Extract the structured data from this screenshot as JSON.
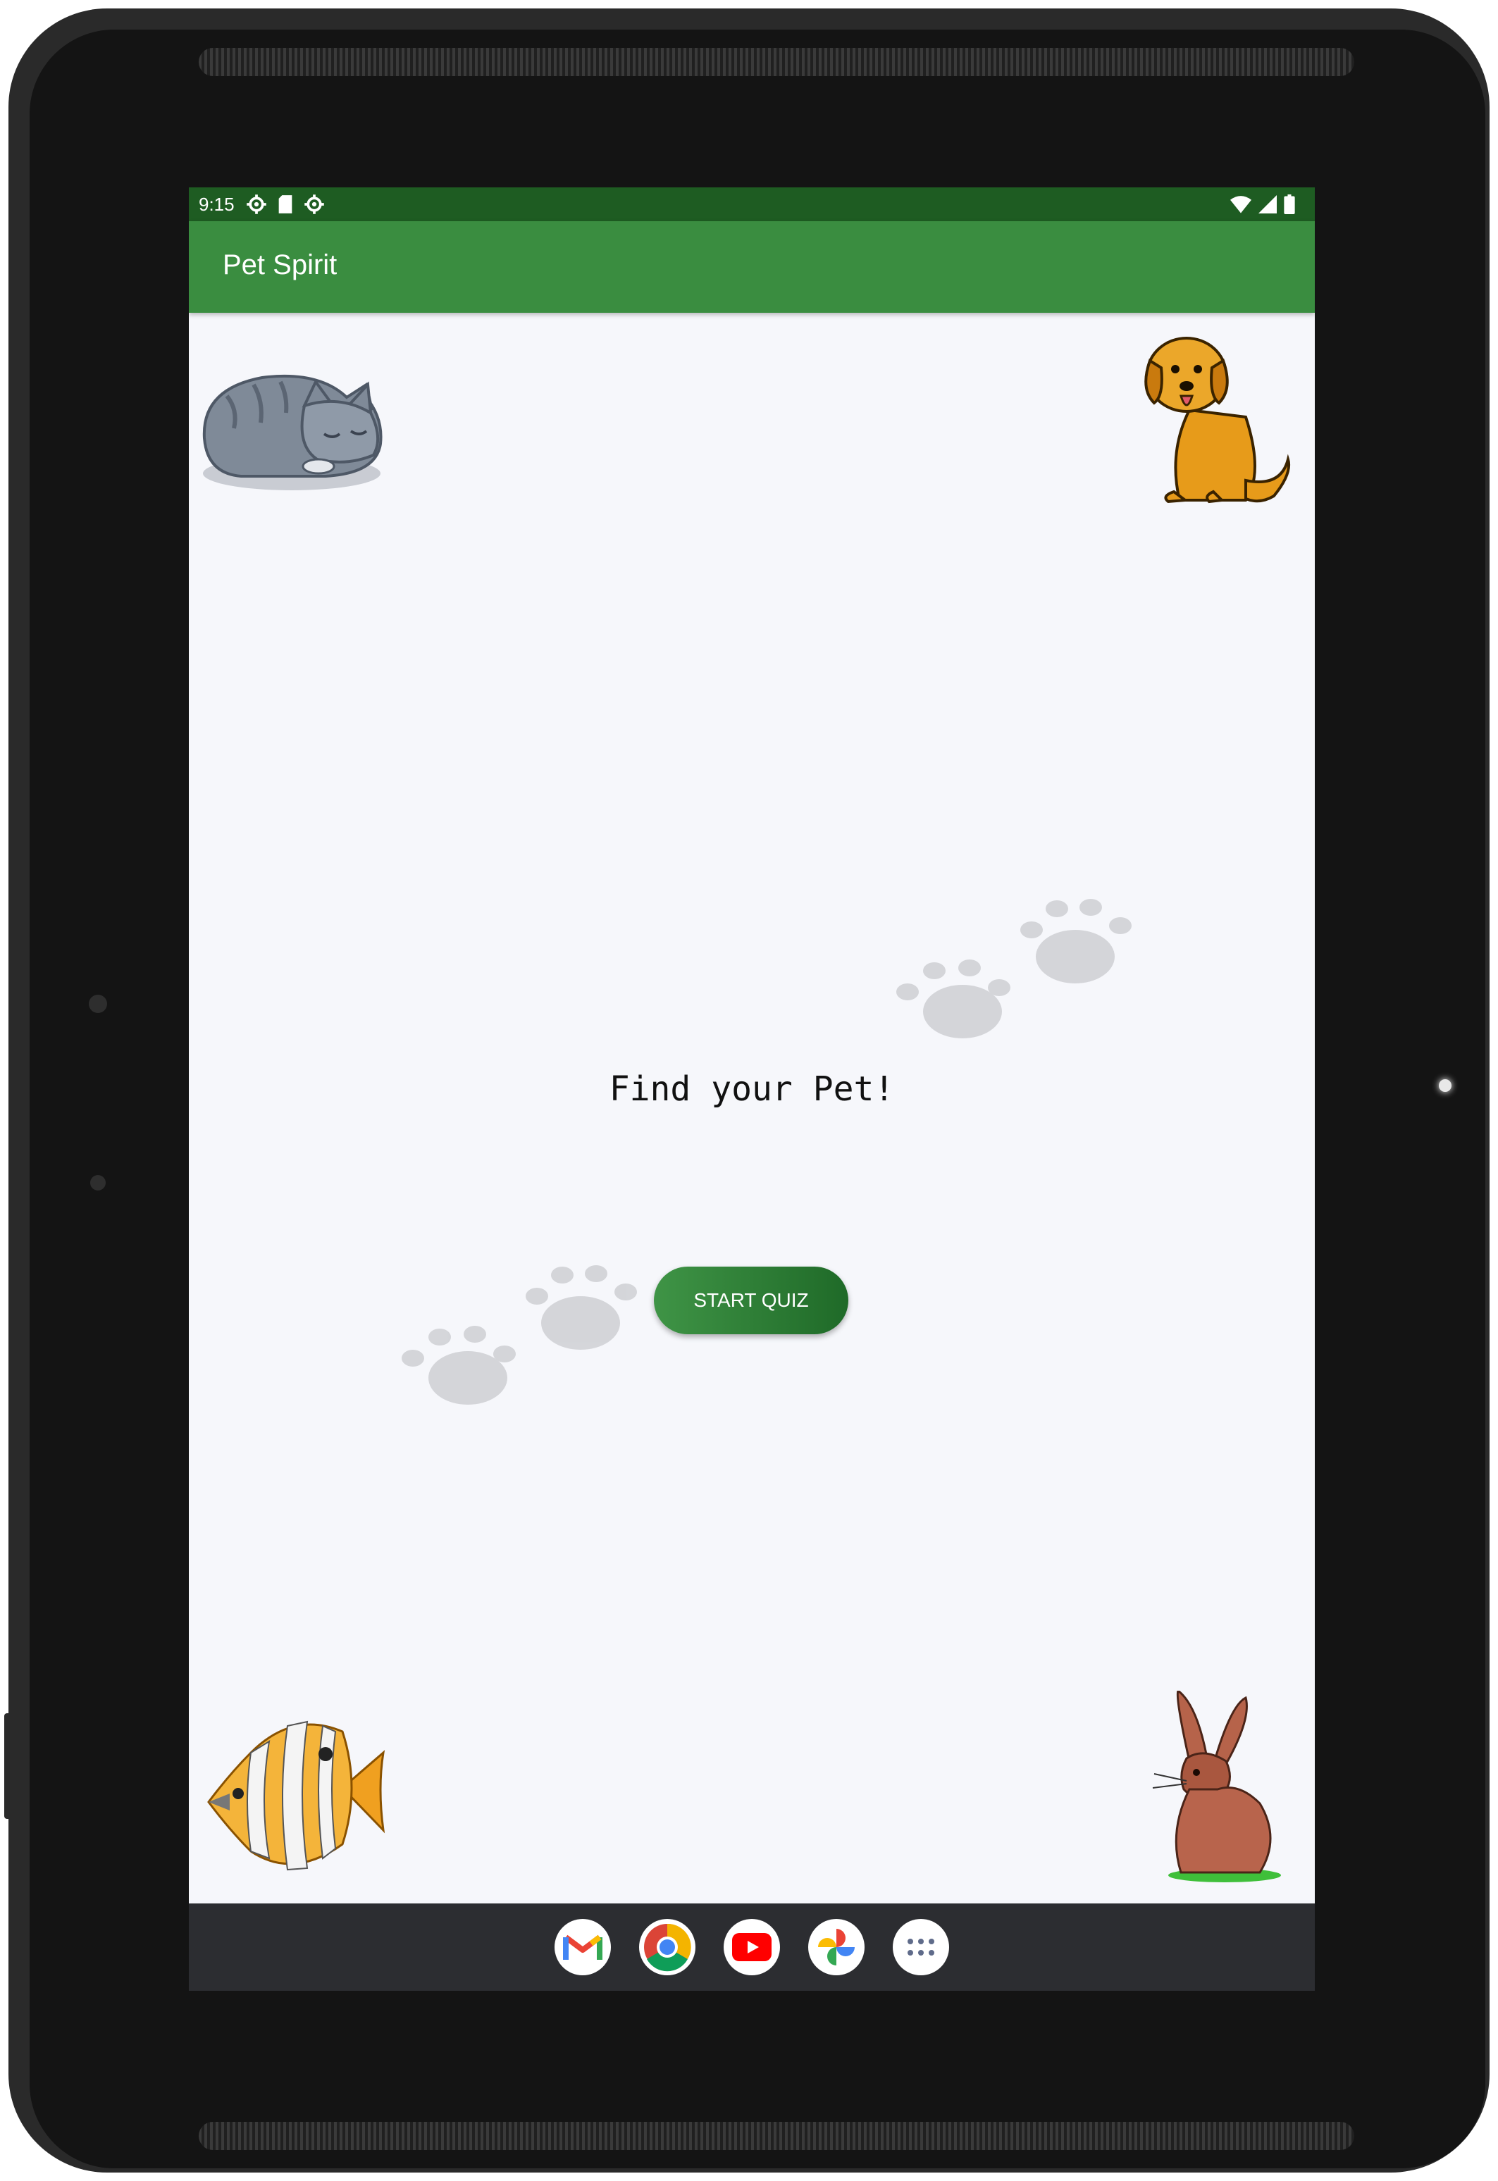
{
  "status_bar": {
    "time": "9:15",
    "left_icons": [
      "settings-icon",
      "sd-card-icon",
      "settings-icon"
    ],
    "right_icons": [
      "wifi-icon",
      "signal-icon",
      "battery-icon"
    ]
  },
  "app_bar": {
    "title": "Pet Spirit",
    "color": "#3a8d40"
  },
  "main": {
    "headline": "Find your Pet!",
    "start_button_label": "START QUIZ",
    "images": [
      "sleeping-cat",
      "sitting-dog",
      "tropical-fish",
      "brown-rabbit"
    ],
    "decorations": [
      "paw-prints",
      "paw-prints"
    ]
  },
  "dock": {
    "apps": [
      "gmail",
      "chrome",
      "youtube",
      "photos",
      "app-drawer"
    ]
  },
  "colors": {
    "status_bar": "#1e5c22",
    "accent_green": "#3a8d40",
    "button_dark": "#1f6a28",
    "background": "#f6f7fb",
    "dock": "#2c2d31"
  }
}
